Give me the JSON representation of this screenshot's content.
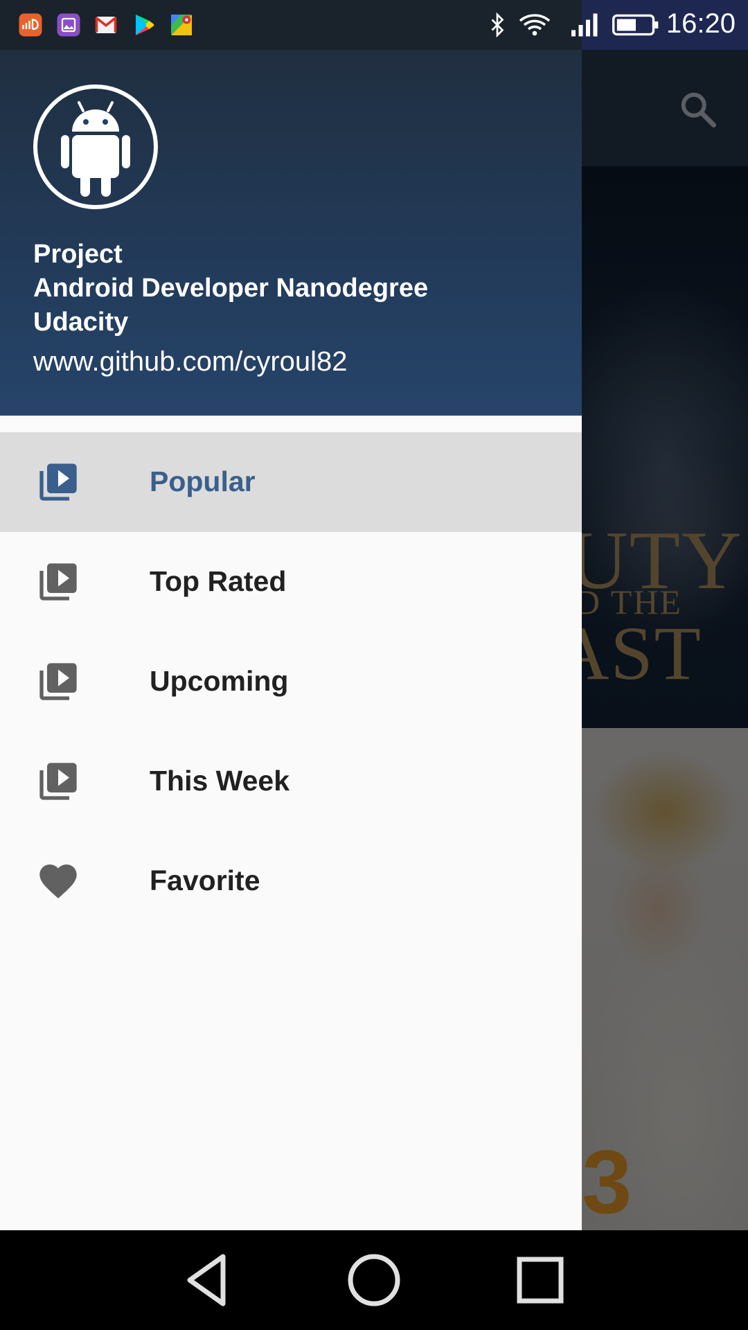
{
  "status_bar": {
    "time": "16:20",
    "notification_icons": [
      "soundcloud-icon",
      "gallery-icon",
      "gmail-icon",
      "play-store-icon",
      "maps-icon"
    ],
    "system_icons": [
      "bluetooth-icon",
      "wifi-icon",
      "signal-icon",
      "battery-icon"
    ]
  },
  "drawer": {
    "header": {
      "avatar_icon": "android-robot-icon",
      "line1": "Project",
      "line2": "Android Developer Nanodegree",
      "line3": "Udacity",
      "url": "www.github.com/cyroul82"
    },
    "menu": [
      {
        "label": "Popular",
        "icon": "video-library-icon",
        "selected": true
      },
      {
        "label": "Top Rated",
        "icon": "video-library-icon",
        "selected": false
      },
      {
        "label": "Upcoming",
        "icon": "video-library-icon",
        "selected": false
      },
      {
        "label": "This Week",
        "icon": "video-library-icon",
        "selected": false
      },
      {
        "label": "Favorite",
        "icon": "heart-icon",
        "selected": false
      }
    ]
  },
  "background_app": {
    "toolbar_action": "search-icon",
    "posters": [
      {
        "visible_text": "UTY D THE AST"
      },
      {
        "visible_text": "3"
      }
    ]
  },
  "nav_bar": {
    "buttons": [
      "back-icon",
      "home-icon",
      "recents-icon"
    ]
  },
  "colors": {
    "drawer_header": "#223a58",
    "selected_text": "#3a5f8c",
    "selected_bg": "#dcdcdc",
    "icon_gray": "#616161"
  }
}
